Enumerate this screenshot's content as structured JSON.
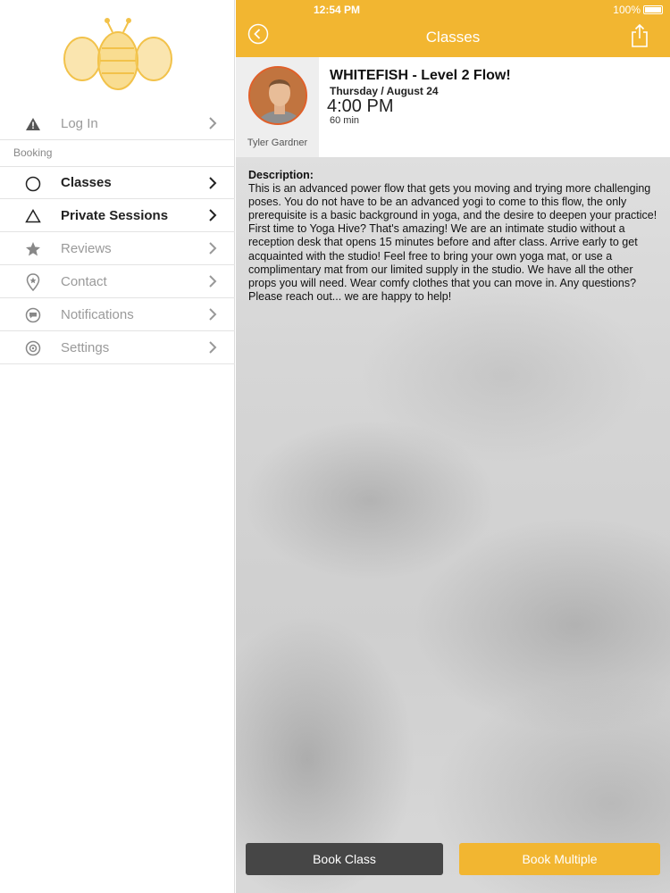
{
  "status": {
    "time": "12:54 PM",
    "battery": "100%"
  },
  "sidebar": {
    "login_label": "Log In",
    "section_label": "Booking",
    "items": [
      {
        "label": "Classes",
        "icon": "circle-icon",
        "active": true
      },
      {
        "label": "Private Sessions",
        "icon": "triangle-icon",
        "active": true
      },
      {
        "label": "Reviews",
        "icon": "star-icon",
        "active": false
      },
      {
        "label": "Contact",
        "icon": "map-pin-icon",
        "active": false
      },
      {
        "label": "Notifications",
        "icon": "chat-bubble-icon",
        "active": false
      },
      {
        "label": "Settings",
        "icon": "gear-icon",
        "active": false
      }
    ]
  },
  "nav": {
    "title": "Classes"
  },
  "class": {
    "title": "WHITEFISH - Level 2 Flow!",
    "date": "Thursday / August 24",
    "time": "4:00 PM",
    "duration": "60 min",
    "instructor": "Tyler Gardner",
    "description_label": "Description:",
    "description": "This is an advanced power flow that gets you moving and trying more challenging poses. You do not have to be an advanced yogi to come to this flow, the only prerequisite is a basic background in yoga, and the desire to deepen your practice! First time to Yoga Hive? That's amazing! We are an intimate studio without a reception desk that opens 15 minutes before and after class. Arrive early to get acquainted with the studio! Feel free to bring your own yoga mat, or use a complimentary mat from our limited supply in the studio. We have all the other props you will need. Wear comfy clothes that you can move in. Any questions? Please reach out... we are happy to help!"
  },
  "buttons": {
    "book_class": "Book Class",
    "book_multiple": "Book Multiple"
  },
  "colors": {
    "accent": "#f2b631",
    "dark_button": "#464646"
  }
}
